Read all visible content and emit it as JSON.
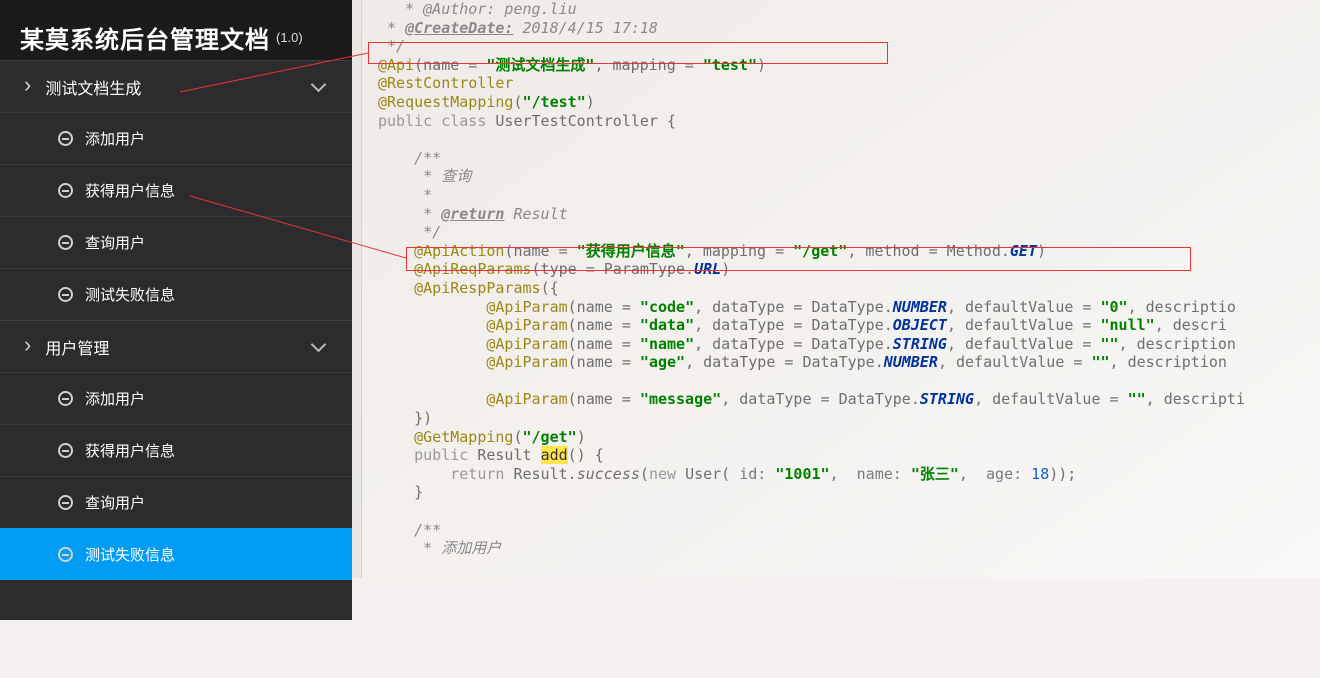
{
  "header": {
    "title": "某莫系统后台管理文档",
    "version": "(1.0)"
  },
  "sidebar": {
    "groups": [
      {
        "id": "test-doc-gen",
        "label": "测试文档生成",
        "expanded": true,
        "items": [
          {
            "id": "add-user-1",
            "label": "添加用户"
          },
          {
            "id": "get-user-info-1",
            "label": "获得用户信息"
          },
          {
            "id": "query-user-1",
            "label": "查询用户"
          },
          {
            "id": "test-fail-1",
            "label": "测试失败信息"
          }
        ]
      },
      {
        "id": "user-mgmt",
        "label": "用户管理",
        "expanded": true,
        "items": [
          {
            "id": "add-user-2",
            "label": "添加用户"
          },
          {
            "id": "get-user-info-2",
            "label": "获得用户信息"
          },
          {
            "id": "query-user-2",
            "label": "查询用户"
          },
          {
            "id": "test-fail-2",
            "label": "测试失败信息",
            "active": true
          }
        ]
      }
    ]
  },
  "code": {
    "author_line": "   * @Author: peng.liu",
    "create_label": "@CreateDate:",
    "create_value": " 2018/4/15 17:18",
    "api": {
      "name": "测试文档生成",
      "mapping": "test"
    },
    "ctrl_name": "UserTestController",
    "request_mapping": "/test",
    "doc_query": "查询",
    "doc_return": "@return",
    "doc_return_val": "Result",
    "api_action": {
      "name": "获得用户信息",
      "mapping": "/get",
      "method": "GET"
    },
    "req_param_type": "URL",
    "resp_params": [
      {
        "name": "code",
        "dataType": "NUMBER",
        "defaultValue": "\"0\""
      },
      {
        "name": "data",
        "dataType": "OBJECT",
        "defaultValue": "\"null\""
      },
      {
        "name": "name",
        "dataType": "STRING",
        "defaultValue": "\"\""
      },
      {
        "name": "age",
        "dataType": "NUMBER",
        "defaultValue": "\"\""
      },
      {
        "name": "message",
        "dataType": "STRING",
        "defaultValue": "\"\""
      }
    ],
    "get_mapping": "/get",
    "method_name": "add",
    "return_user": {
      "id": "1001",
      "name": "张三",
      "age": 18
    },
    "doc_add": "添加用户"
  }
}
